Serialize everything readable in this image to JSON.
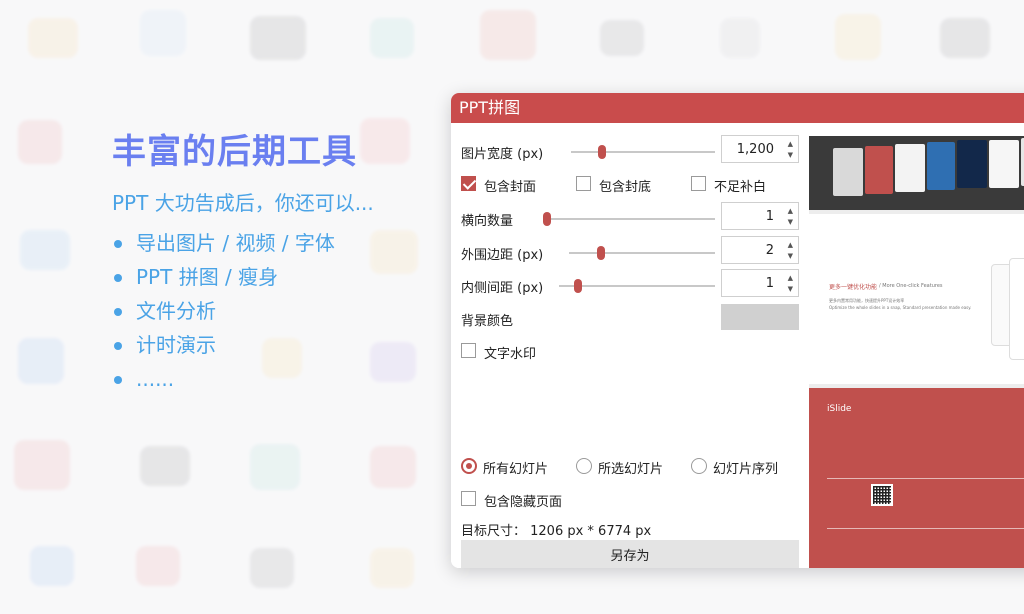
{
  "promo": {
    "title": "丰富的后期工具",
    "subtitle": "PPT 大功告成后，你还可以...",
    "items": [
      "导出图片 / 视频 / 字体",
      "PPT 拼图 / 瘦身",
      "文件分析",
      "计时演示",
      "......"
    ]
  },
  "window": {
    "title": "PPT拼图",
    "image_width": {
      "label": "图片宽度 (px)",
      "value": "1,200",
      "slider_fraction": 0.2
    },
    "options": [
      {
        "label": "包含封面",
        "checked": true
      },
      {
        "label": "包含封底",
        "checked": false
      },
      {
        "label": "不足补白",
        "checked": false
      }
    ],
    "horizontal_count": {
      "label": "横向数量",
      "value": "1",
      "slider_fraction": 0.0
    },
    "outer_margin": {
      "label": "外围边距 (px)",
      "value": "2",
      "slider_fraction": 0.2
    },
    "inner_spacing": {
      "label": "内侧间距 (px)",
      "value": "1",
      "slider_fraction": 0.1
    },
    "background_color": {
      "label": "背景颜色",
      "value": "#d0d0d0"
    },
    "text_watermark": {
      "label": "文字水印",
      "checked": false
    },
    "slide_scope": [
      {
        "label": "所有幻灯片",
        "selected": true
      },
      {
        "label": "所选幻灯片",
        "selected": false
      },
      {
        "label": "幻灯片序列",
        "selected": false
      }
    ],
    "include_hidden": {
      "label": "包含隐藏页面",
      "checked": false
    },
    "target_size": "目标尺寸： 1206 px *  6774 px",
    "save_label": "另存为"
  },
  "preview": {
    "slide2_heading": "更多一键优化功能",
    "slide2_heading_en": "/ More One-click Features",
    "slide2_body_cn": "更多内置常用功能，快速提升PPT设计效率",
    "slide2_body_en": "Optimize the whole slides in a snap, Standard presentation made easy.",
    "brand": "iSlide"
  },
  "colors": {
    "accent": "#c0504d",
    "promo_title": "#6a7ff0",
    "promo_text": "#4aa3e6"
  }
}
